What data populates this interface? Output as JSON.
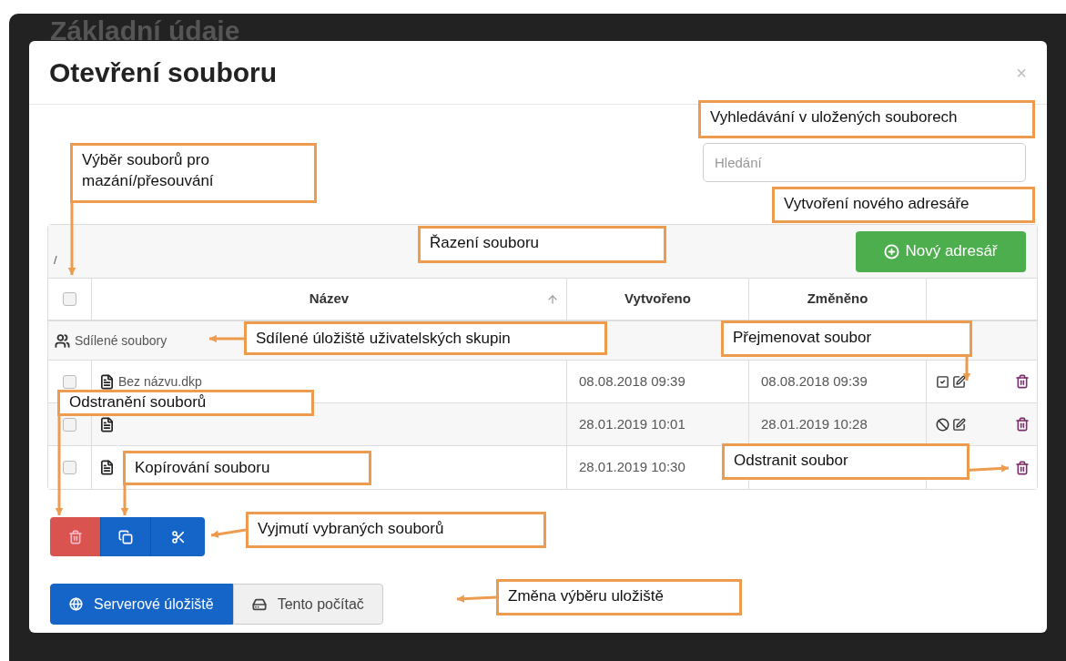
{
  "background": {
    "title": "Základní údaje"
  },
  "dialog": {
    "title": "Otevření souboru",
    "close": "×"
  },
  "search": {
    "placeholder": "Hledání"
  },
  "path": "/",
  "new_folder_button": "Nový adresář",
  "table": {
    "columns": [
      "Název",
      "Vytvořeno",
      "Změněno"
    ],
    "select_all": {
      "checked": false
    },
    "shared_row": "Sdílené soubory",
    "rows": [
      {
        "name": "Bez názvu.dkp",
        "created": "08.08.2018 09:39",
        "modified": "08.08.2018 09:39",
        "checked": false,
        "kind": "check"
      },
      {
        "created": "28.01.2019 10:01",
        "modified": "28.01.2019 10:28",
        "checked": false,
        "kind": "ban"
      },
      {
        "created": "28.01.2019 10:30",
        "checked": false
      }
    ]
  },
  "storage_tabs": [
    {
      "label": "Serverové úložiště",
      "selected": true
    },
    {
      "label": "Tento počítač",
      "selected": false
    }
  ],
  "callouts": [
    {
      "text": "Výběr souborů pro mazání/přesouvání"
    },
    {
      "text": "Vyhledávání v uložených souborech"
    },
    {
      "text": "Vytvoření nového adresáře"
    },
    {
      "text": "Řazení souboru"
    },
    {
      "text": "Sdílené úložiště uživatelských skupin"
    },
    {
      "text": "Přejmenovat soubor"
    },
    {
      "text": "Odstranění souborů"
    },
    {
      "text": "Kopírování souboru"
    },
    {
      "text": "Odstranit soubor"
    },
    {
      "text": "Vyjmutí vybraných souborů"
    },
    {
      "text": "Změna výběru uložiště"
    }
  ]
}
